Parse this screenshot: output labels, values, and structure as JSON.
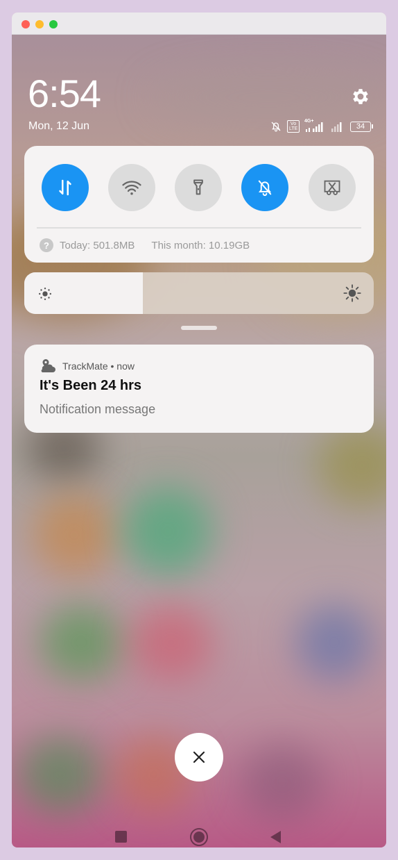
{
  "lock": {
    "time": "6:54",
    "date": "Mon, 12 Jun"
  },
  "status": {
    "net_type": "4G+",
    "volte": "Vo LTE",
    "battery": "34"
  },
  "quick_settings": {
    "tiles": [
      {
        "name": "mobile-data",
        "icon": "data-arrows-icon",
        "active": true
      },
      {
        "name": "wifi",
        "icon": "wifi-icon",
        "active": false
      },
      {
        "name": "flashlight",
        "icon": "flashlight-icon",
        "active": false
      },
      {
        "name": "silent",
        "icon": "bell-off-icon",
        "active": true
      },
      {
        "name": "screenshot",
        "icon": "scissors-icon",
        "active": false
      }
    ],
    "usage_today": "Today: 501.8MB",
    "usage_month": "This month: 10.19GB"
  },
  "brightness": {
    "level": 0.34
  },
  "notification": {
    "app": "TrackMate",
    "sep": " • ",
    "when": "now",
    "title": "It's Been 24 hrs",
    "message": "Notification message"
  },
  "colors": {
    "accent": "#1a94f3",
    "card": "#f5f3f3",
    "tile_off": "#dcdcdc"
  }
}
